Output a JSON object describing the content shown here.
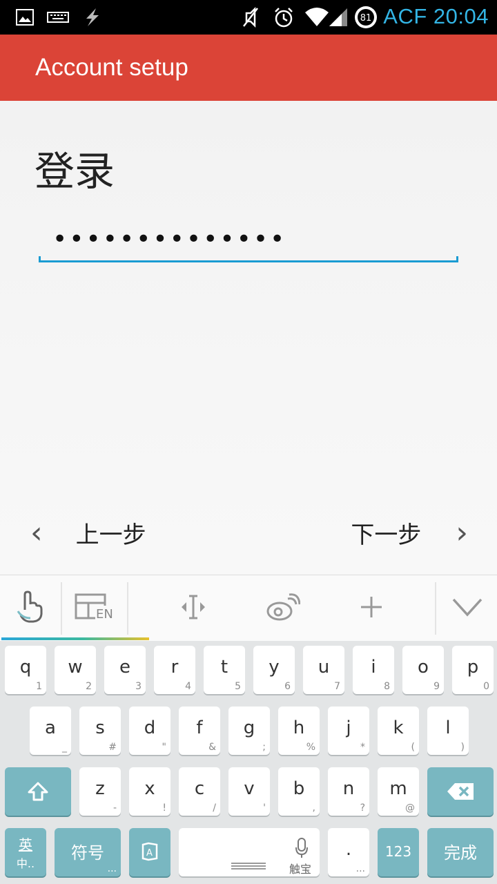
{
  "status_bar": {
    "carrier": "ACF",
    "time": "20:04",
    "battery_level": "81",
    "icons": [
      "image-icon",
      "keyboard-icon",
      "usb-debug-icon",
      "mute-icon",
      "alarm-icon",
      "wifi-icon",
      "signal-icon",
      "battery-icon"
    ]
  },
  "app_bar": {
    "title": "Account setup"
  },
  "main": {
    "heading": "登录",
    "password_value": "••••••••••••••"
  },
  "nav": {
    "back_label": "上一步",
    "next_label": "下一步"
  },
  "keyboard_toolbar": {
    "icons": [
      "gesture-icon",
      "layout-en-icon",
      "cursor-move-icon",
      "weibo-icon",
      "plus-icon",
      "collapse-keyboard-icon"
    ],
    "layout_label": "EN"
  },
  "keyboard": {
    "row1": [
      {
        "k": "q",
        "s": "1"
      },
      {
        "k": "w",
        "s": "2"
      },
      {
        "k": "e",
        "s": "3"
      },
      {
        "k": "r",
        "s": "4"
      },
      {
        "k": "t",
        "s": "5"
      },
      {
        "k": "y",
        "s": "6"
      },
      {
        "k": "u",
        "s": "7"
      },
      {
        "k": "i",
        "s": "8"
      },
      {
        "k": "o",
        "s": "9"
      },
      {
        "k": "p",
        "s": "0"
      }
    ],
    "row2": [
      {
        "k": "a",
        "s": "_"
      },
      {
        "k": "s",
        "s": "#"
      },
      {
        "k": "d",
        "s": "\""
      },
      {
        "k": "f",
        "s": "&"
      },
      {
        "k": "g",
        "s": ";"
      },
      {
        "k": "h",
        "s": "%"
      },
      {
        "k": "j",
        "s": "*"
      },
      {
        "k": "k",
        "s": "("
      },
      {
        "k": "l",
        "s": ")"
      }
    ],
    "row3": [
      {
        "k": "z",
        "s": "-"
      },
      {
        "k": "x",
        "s": "!"
      },
      {
        "k": "c",
        "s": "/"
      },
      {
        "k": "v",
        "s": "'"
      },
      {
        "k": "b",
        "s": ","
      },
      {
        "k": "n",
        "s": "?"
      },
      {
        "k": "m",
        "s": "@"
      }
    ],
    "lang_top": "英",
    "lang_bottom": "中..",
    "symbols_label": "符号",
    "symbols_sub": "...",
    "voice_label": "触宝",
    "period_label": ".",
    "period_sub": "...",
    "num_label": "123",
    "done_label": "完成"
  }
}
